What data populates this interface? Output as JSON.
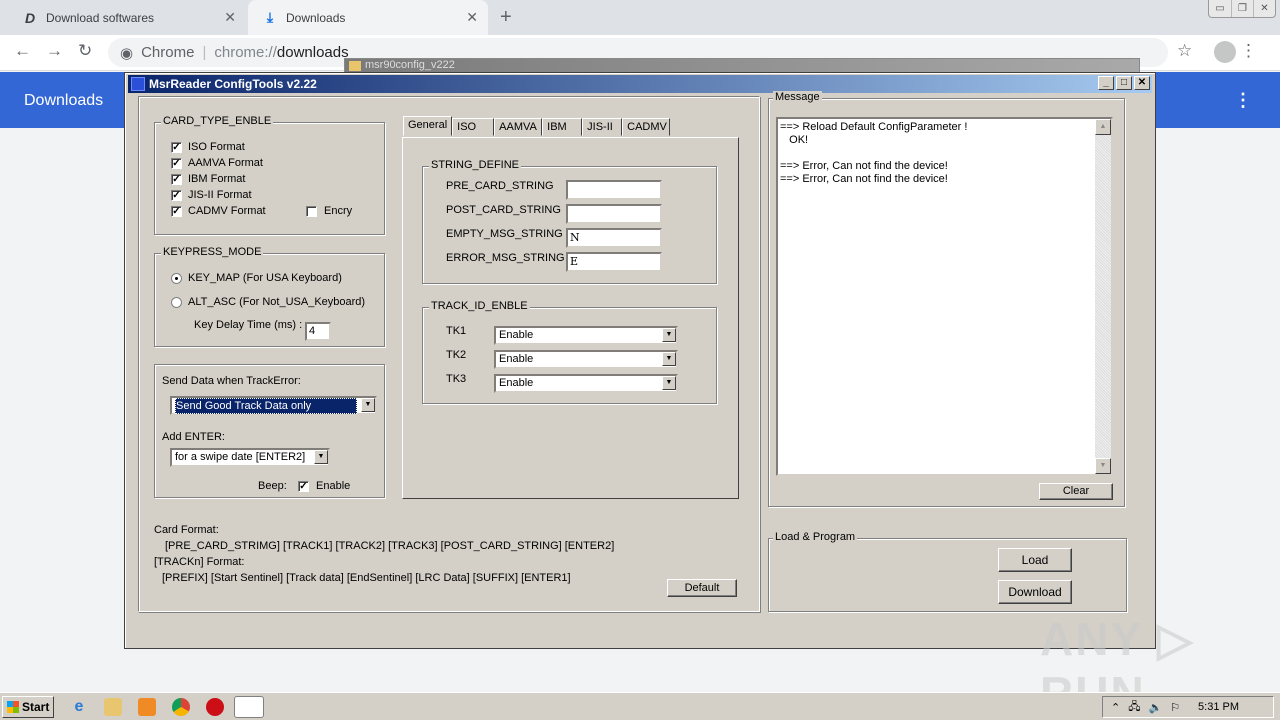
{
  "browser": {
    "tabs": [
      {
        "label": "Download softwares",
        "icon": "d-logo-icon"
      },
      {
        "label": "Downloads",
        "icon": "download-icon"
      }
    ],
    "new_tab": "+",
    "close_glyph": "✕",
    "omnibox": {
      "site": "Chrome",
      "url_prefix": "chrome://",
      "url_path": "downloads"
    },
    "page_title": "Downloads",
    "menu_glyph": "⋮"
  },
  "background_window": {
    "title": "msr90config_v222"
  },
  "app": {
    "title": "MsrReader ConfigTools v2.22",
    "card_type": {
      "title": "CARD_TYPE_ENBLE",
      "items": [
        {
          "label": "ISO Format",
          "checked": true
        },
        {
          "label": "AAMVA Format",
          "checked": true
        },
        {
          "label": "IBM Format",
          "checked": true
        },
        {
          "label": "JIS-II Format",
          "checked": true
        },
        {
          "label": "CADMV Format",
          "checked": true
        }
      ],
      "encry": {
        "label": "Encry",
        "checked": false
      }
    },
    "keypress": {
      "title": "KEYPRESS_MODE",
      "options": [
        {
          "label": "KEY_MAP (For USA Keyboard)",
          "selected": true
        },
        {
          "label": "ALT_ASC (For Not_USA_Keyboard)",
          "selected": false
        }
      ],
      "delay_label": "Key  Delay Time (ms) :",
      "delay_value": "4"
    },
    "send_data": {
      "label": "Send Data when TrackError:",
      "value": "Send Good Track Data only",
      "enter_label": "Add ENTER:",
      "enter_value": "for a swipe date [ENTER2]",
      "beep_label": "Beep:",
      "beep_enable_label": "Enable",
      "beep_checked": true
    },
    "tabs": [
      "General",
      "ISO",
      "AAMVA",
      "IBM",
      "JIS-II",
      "CADMV"
    ],
    "string_define": {
      "title": "STRING_DEFINE",
      "fields": [
        {
          "label": "PRE_CARD_STRING",
          "value": ""
        },
        {
          "label": "POST_CARD_STRING",
          "value": ""
        },
        {
          "label": "EMPTY_MSG_STRING",
          "value": "N"
        },
        {
          "label": "ERROR_MSG_STRING",
          "value": "E"
        }
      ]
    },
    "track_id": {
      "title": "TRACK_ID_ENBLE",
      "tracks": [
        {
          "label": "TK1",
          "value": "Enable"
        },
        {
          "label": "TK2",
          "value": "Enable"
        },
        {
          "label": "TK3",
          "value": "Enable"
        }
      ]
    },
    "format_info": {
      "card_format_label": "Card Format:",
      "card_format": "[PRE_CARD_STRIMG] [TRACK1] [TRACK2] [TRACK3] [POST_CARD_STRING] [ENTER2]",
      "track_format_label": "[TRACKn] Format:",
      "track_format": "[PREFIX] [Start Sentinel] [Track data] [EndSentinel] [LRC Data] [SUFFIX] [ENTER1]"
    },
    "default_button": "Default",
    "message": {
      "title": "Message",
      "lines": [
        "==> Reload Default ConfigParameter !",
        "   OK!",
        "",
        "==> Error, Can not find the device!",
        "==> Error, Can not find the device!"
      ],
      "clear_button": "Clear"
    },
    "load_program": {
      "title": "Load & Program",
      "load_button": "Load",
      "download_button": "Download"
    }
  },
  "taskbar": {
    "start_label": "Start",
    "clock": "5:31 PM"
  },
  "watermark": "ANY ▷ RUN"
}
